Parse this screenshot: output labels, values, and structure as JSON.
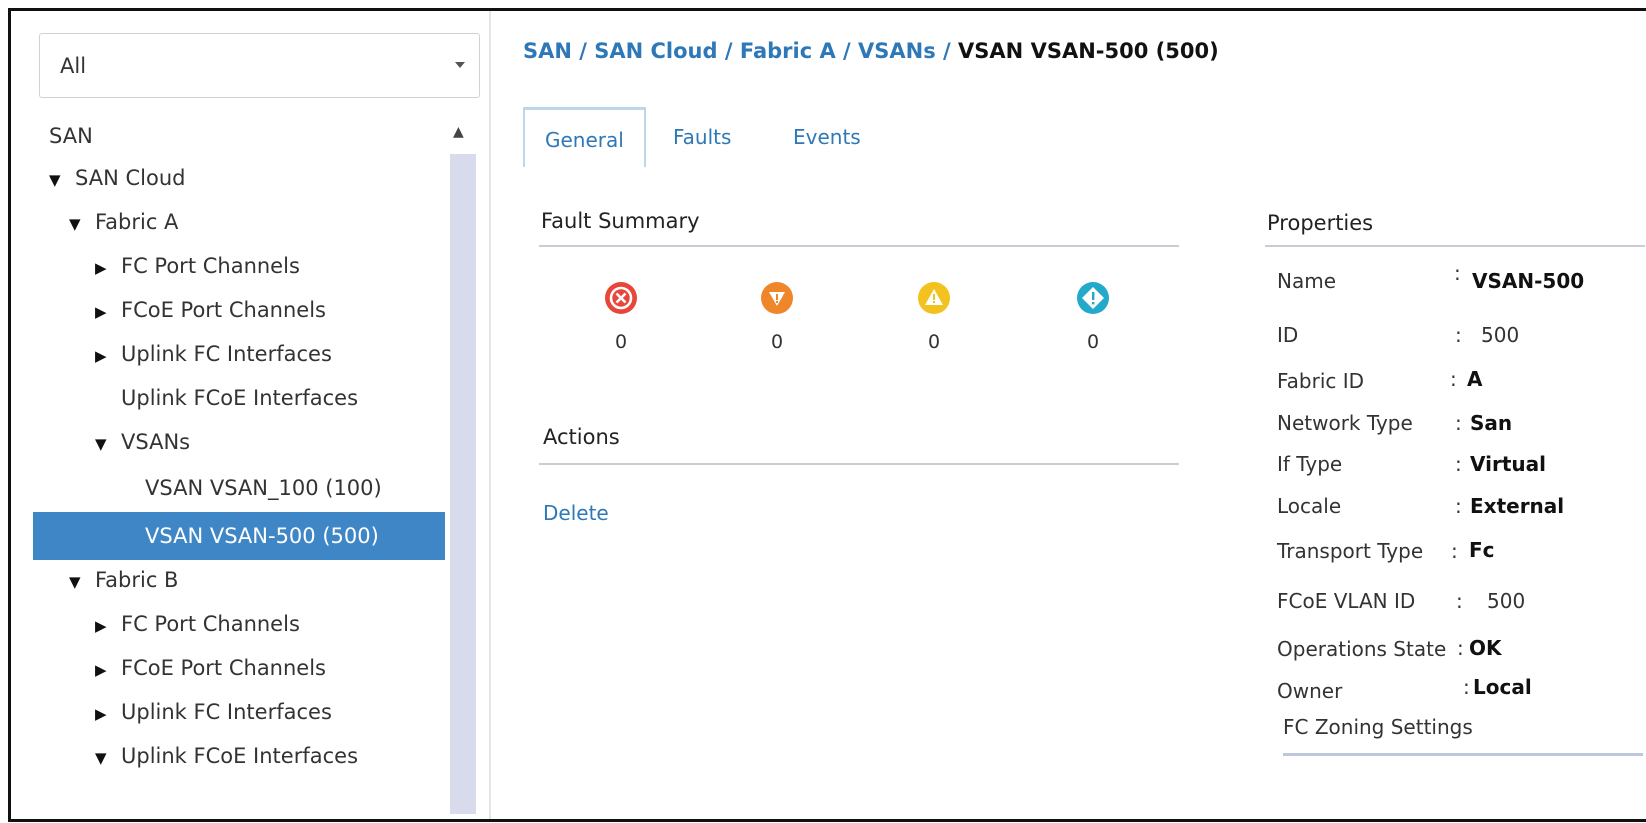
{
  "filter": {
    "value": "All"
  },
  "tree": [
    {
      "label": "SAN",
      "toggle": ""
    },
    {
      "label": "SAN Cloud",
      "toggle": "▼"
    },
    {
      "label": "Fabric A",
      "toggle": "▼"
    },
    {
      "label": "FC Port Channels",
      "toggle": "▶"
    },
    {
      "label": "FCoE Port Channels",
      "toggle": "▶"
    },
    {
      "label": "Uplink FC Interfaces",
      "toggle": "▶"
    },
    {
      "label": "Uplink FCoE Interfaces",
      "toggle": ""
    },
    {
      "label": "VSANs",
      "toggle": "▼"
    },
    {
      "label": "VSAN VSAN_100 (100)",
      "toggle": ""
    },
    {
      "label": "VSAN VSAN-500 (500)",
      "toggle": ""
    },
    {
      "label": "Fabric B",
      "toggle": "▼"
    },
    {
      "label": "FC Port Channels",
      "toggle": "▶"
    },
    {
      "label": "FCoE Port Channels",
      "toggle": "▶"
    },
    {
      "label": "Uplink FC Interfaces",
      "toggle": "▶"
    },
    {
      "label": "Uplink FCoE Interfaces",
      "toggle": "▼"
    }
  ],
  "breadcrumb": {
    "links": [
      "SAN",
      "SAN Cloud",
      "Fabric A",
      "VSANs"
    ],
    "separator": " / ",
    "current": "VSAN VSAN-500 (500)"
  },
  "tabs": [
    "General",
    "Faults",
    "Events"
  ],
  "fault_summary": {
    "title": "Fault Summary",
    "items": [
      {
        "icon": "critical-fault-icon",
        "color": "#e8463a",
        "count": "0"
      },
      {
        "icon": "major-fault-icon",
        "color": "#f0862a",
        "count": "0"
      },
      {
        "icon": "minor-fault-icon",
        "color": "#f4c21f",
        "count": "0"
      },
      {
        "icon": "warning-fault-icon",
        "color": "#23a9c9",
        "count": "0"
      }
    ]
  },
  "actions": {
    "title": "Actions",
    "delete": "Delete"
  },
  "properties": {
    "title": "Properties",
    "rows": [
      {
        "label": "Name",
        "colon": ":",
        "value": "VSAN-500"
      },
      {
        "label": "ID",
        "colon": ":",
        "value": "500"
      },
      {
        "label": "Fabric ID",
        "colon": ":",
        "value": "A"
      },
      {
        "label": "Network Type",
        "colon": ":",
        "value": "San"
      },
      {
        "label": "If Type",
        "colon": ":",
        "value": "Virtual"
      },
      {
        "label": "Locale",
        "colon": ":",
        "value": "External"
      },
      {
        "label": "Transport Type",
        "colon": ":",
        "value": "Fc"
      },
      {
        "label": "FCoE VLAN ID",
        "colon": ":",
        "value": "500"
      },
      {
        "label": "Operations State",
        "colon": ":",
        "value": "OK"
      },
      {
        "label": "Owner",
        "colon": ":",
        "value": "Local"
      }
    ],
    "footer": "FC Zoning Settings"
  }
}
